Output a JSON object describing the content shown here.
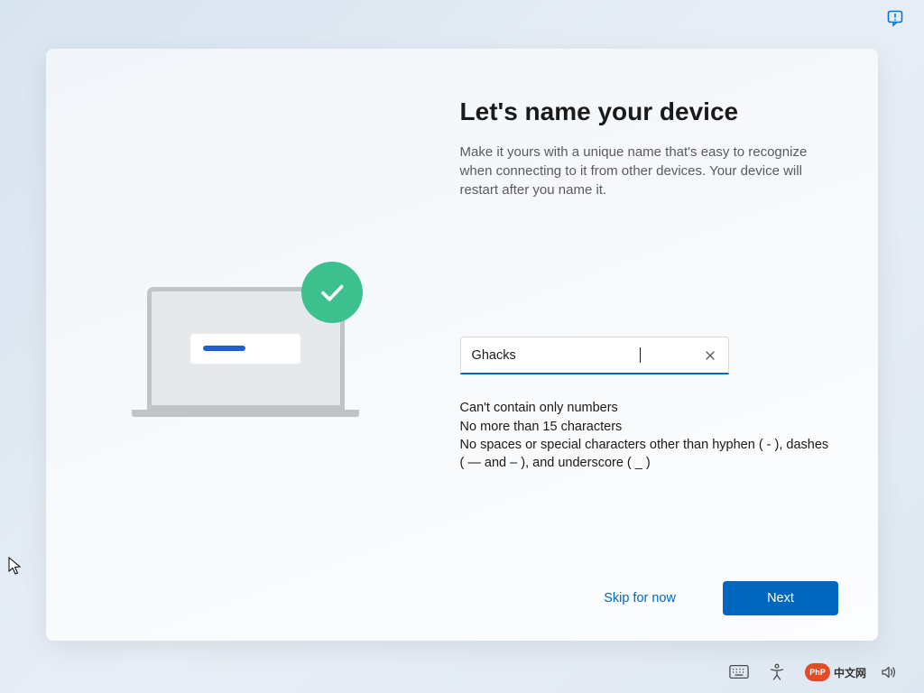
{
  "heading": "Let's name your device",
  "description": "Make it yours with a unique name that's easy to recognize when connecting to it from other devices. Your device will restart after you name it.",
  "input": {
    "value": "Ghacks",
    "placeholder": ""
  },
  "rules": {
    "line1": "Can't contain only numbers",
    "line2": "No more than 15 characters",
    "line3": "No spaces or special characters other than hyphen ( - ), dashes ( — and – ), and underscore ( _ )"
  },
  "buttons": {
    "skip": "Skip for now",
    "next": "Next"
  },
  "watermark": {
    "php": "PhP",
    "cn": "中文网"
  }
}
